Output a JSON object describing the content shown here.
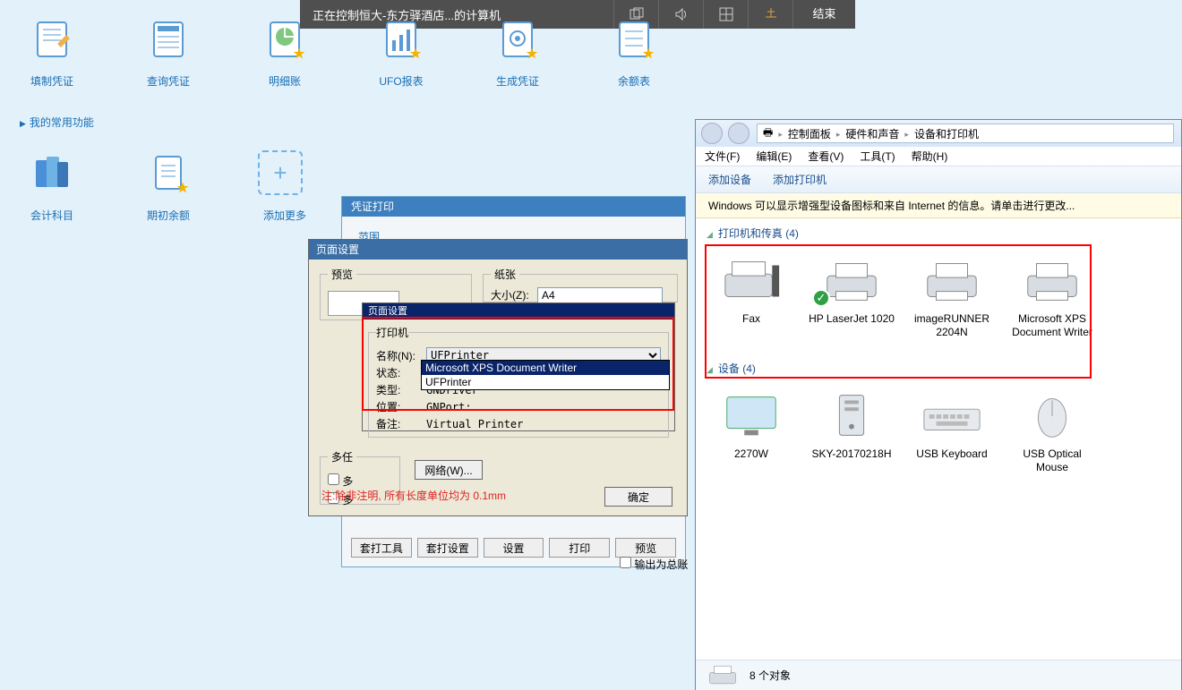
{
  "remote": {
    "message": "正在控制恒大-东方驿酒店...的计算机",
    "end": "结束"
  },
  "row1": [
    {
      "name": "fill-voucher",
      "label": "填制凭证"
    },
    {
      "name": "query-voucher",
      "label": "查询凭证"
    },
    {
      "name": "detail-ledger",
      "label": "明细账"
    },
    {
      "name": "ufo-report",
      "label": "UFO报表"
    },
    {
      "name": "gen-voucher",
      "label": "生成凭证"
    },
    {
      "name": "balance-table",
      "label": "余额表"
    }
  ],
  "favfun": "我的常用功能",
  "row2": [
    {
      "name": "accounting-subject",
      "label": "会计科目"
    },
    {
      "name": "opening-balance",
      "label": "期初余额"
    },
    {
      "name": "add-more",
      "label": "添加更多"
    }
  ],
  "vprint": {
    "title": "凭证打印",
    "tab": "范围",
    "buttons": [
      "套打工具",
      "套打设置",
      "设置",
      "打印",
      "预览"
    ]
  },
  "output_total": "输出为总账",
  "pagesetup": {
    "title": "页面设置",
    "preview_legend": "预览",
    "paper_legend": "纸张",
    "size_label": "大小(Z):",
    "size_value": "A4",
    "multi_legend": "多任",
    "multi1": "多",
    "multi2": "多",
    "net_btn": "网络(W)...",
    "note": "注:除非注明, 所有长度单位均为 0.1mm",
    "ok": "确定"
  },
  "psel": {
    "title": "页面设置",
    "legend": "打印机",
    "name_label": "名称(N):",
    "name_value": "UFPrinter",
    "status_label": "状态:",
    "type_label": "类型:",
    "type_value": "GNDriver",
    "location_label": "位置:",
    "location_value": "GNPort:",
    "comment_label": "备注:",
    "comment_value": "Virtual Printer",
    "options": [
      "Microsoft XPS Document Writer",
      "UFPrinter"
    ]
  },
  "cp": {
    "crumbs": [
      "控制面板",
      "硬件和声音",
      "设备和打印机"
    ],
    "menu": [
      "文件(F)",
      "编辑(E)",
      "查看(V)",
      "工具(T)",
      "帮助(H)"
    ],
    "cmds": [
      "添加设备",
      "添加打印机"
    ],
    "infobar": "Windows 可以显示增强型设备图标和来自 Internet 的信息。请单击进行更改...",
    "printers_head": "打印机和传真 (4)",
    "printers": [
      {
        "name": "fax",
        "label": "Fax"
      },
      {
        "name": "hp1020",
        "label": "HP LaserJet 1020",
        "default": true
      },
      {
        "name": "ir2204n",
        "label": "imageRUNNER 2204N"
      },
      {
        "name": "msxps",
        "label": "Microsoft XPS Document Writer"
      }
    ],
    "devices_head": "设备 (4)",
    "devices": [
      {
        "name": "monitor",
        "label": "2270W"
      },
      {
        "name": "pc",
        "label": "SKY-20170218H"
      },
      {
        "name": "keyboard",
        "label": "USB Keyboard"
      },
      {
        "name": "mouse",
        "label": "USB Optical Mouse"
      }
    ],
    "status": "8 个对象"
  }
}
